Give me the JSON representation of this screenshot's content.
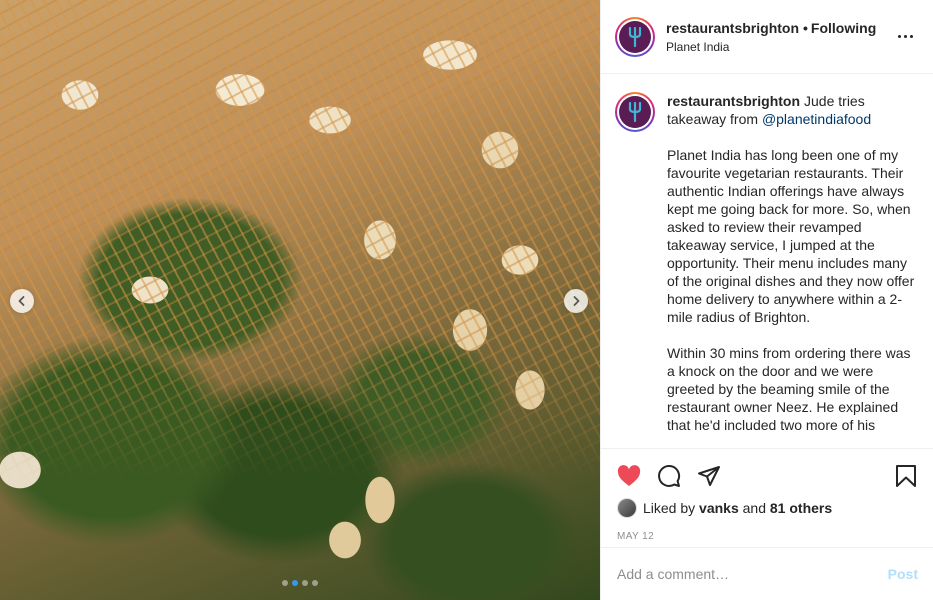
{
  "photo": {
    "alt": "",
    "carousel": {
      "total": 4,
      "active_index": 1
    },
    "prev_icon": "chevron-left-icon",
    "next_icon": "chevron-right-icon"
  },
  "header": {
    "username": "restaurantsbrighton",
    "separator": "•",
    "follow_status": "Following",
    "location": "Planet India",
    "more_icon": "more-options-icon"
  },
  "caption": {
    "username": "restaurantsbrighton",
    "intro": "Jude tries takeaway from",
    "mention": "@planetindiafood",
    "paragraphs": [
      "Planet India has long been one of my favourite vegetarian restaurants. Their authentic Indian offerings have always kept me going back for more. So, when asked to review their revamped takeaway service, I jumped at the opportunity. Their menu includes many of the original dishes and they now offer home delivery to anywhere within a 2-mile radius of Brighton.",
      "Within 30 mins from ordering there was a knock on the door and we were greeted by the beaming smile of the restaurant owner Neez. He explained that he'd included two more of his"
    ]
  },
  "actions": {
    "like_icon": "heart-icon",
    "comment_icon": "comment-icon",
    "share_icon": "share-icon",
    "save_icon": "bookmark-icon",
    "liked": true
  },
  "likes": {
    "prefix": "Liked by",
    "user": "vanks",
    "conj": "and",
    "others": "81 others"
  },
  "date": "MAY 12",
  "comment": {
    "placeholder": "Add a comment…",
    "post_label": "Post"
  },
  "colors": {
    "like_red": "#ed4956",
    "link_blue": "#00376b",
    "post_disabled": "#b2dffc",
    "carousel_active": "#3897f0",
    "avatar_bg": "#5a1c54",
    "avatar_fork": "#3fb6d4"
  }
}
